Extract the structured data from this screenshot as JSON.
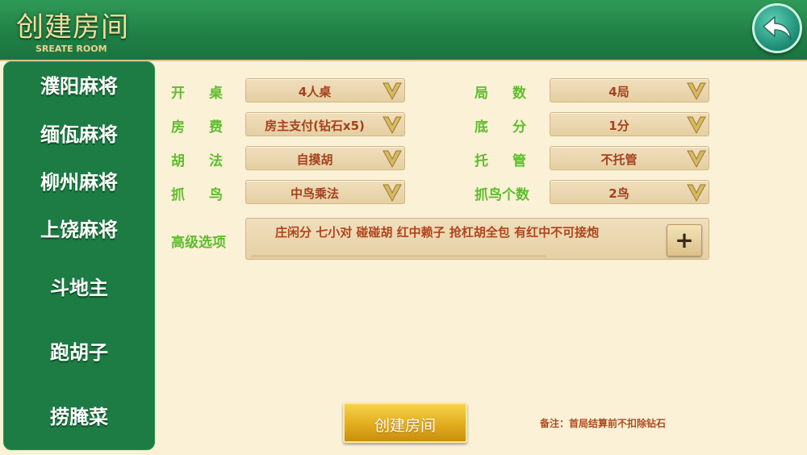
{
  "header": {
    "title": "创建房间",
    "subtitle": "SREATE ROOM",
    "back_icon": "back-arrow-icon"
  },
  "sidebar": {
    "items": [
      {
        "label": "濮阳麻将"
      },
      {
        "label": "缅佤麻将"
      },
      {
        "label": "柳州麻将"
      },
      {
        "label": "上饶麻将"
      },
      {
        "label": "斗地主"
      },
      {
        "label": "跑胡子"
      },
      {
        "label": "捞腌菜"
      }
    ]
  },
  "options": {
    "table": {
      "label": "开桌",
      "value": "4人桌"
    },
    "rounds": {
      "label": "局数",
      "value": "4局"
    },
    "fee": {
      "label": "房费",
      "value": "房主支付(钻石x5)"
    },
    "base_score": {
      "label": "底分",
      "value": "1分"
    },
    "hu_rule": {
      "label": "胡法",
      "value": "自摸胡"
    },
    "auto_play": {
      "label": "托管",
      "value": "不托管"
    },
    "bird": {
      "label": "抓鸟",
      "value": "中鸟乘法"
    },
    "bird_count": {
      "label": "抓鸟个数",
      "value": "2鸟"
    }
  },
  "advanced": {
    "label": "高级选项",
    "value": "庄闲分 七小对 碰碰胡 红中赖子 抢杠胡全包 有红中不可接炮",
    "plus_label": "+"
  },
  "footer": {
    "create_label": "创建房间",
    "note": "备注：首局结算前不扣除钻石"
  },
  "colors": {
    "header_green": "#1f7f45",
    "label_green": "#5ebd2c",
    "value_red": "#a5411d",
    "background": "#fbf1d6",
    "button_gold": "#e0a91a"
  }
}
